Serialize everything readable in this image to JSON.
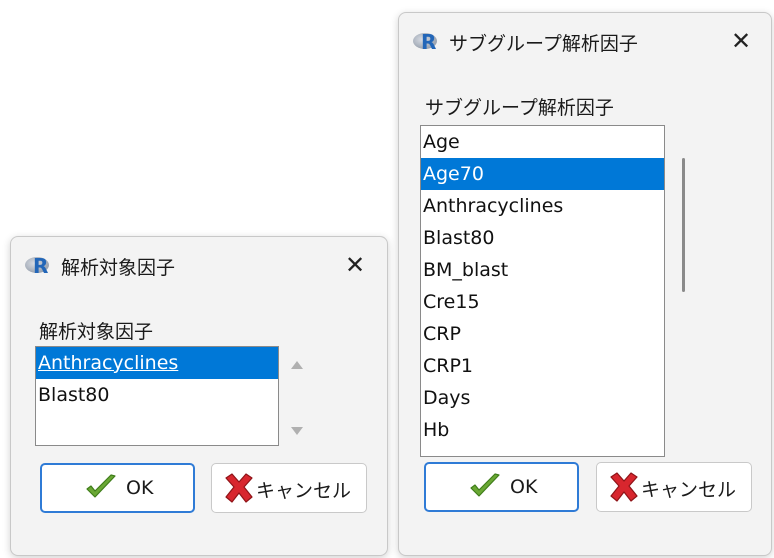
{
  "dialog_left": {
    "title": "解析対象因子",
    "list_label": "解析対象因子",
    "items": [
      "Anthracyclines",
      "Blast80"
    ],
    "selected_index": 0,
    "ok_label": "OK",
    "cancel_label": "キャンセル",
    "close_glyph": "✕"
  },
  "dialog_right": {
    "title": "サブグループ解析因子",
    "list_label": "サブグループ解析因子",
    "items": [
      "Age",
      "Age70",
      "Anthracyclines",
      "Blast80",
      "BM_blast",
      "Cre15",
      "CRP",
      "CRP1",
      "Days",
      "Hb"
    ],
    "selected_index": 1,
    "ok_label": "OK",
    "cancel_label": "キャンセル",
    "close_glyph": "✕"
  },
  "colors": {
    "selection": "#0078d7",
    "dialog_bg": "#f3f3f3",
    "default_button_border": "#2f7bd6",
    "check_green": "#6aa834",
    "cancel_red": "#d8262e"
  },
  "icons": {
    "app_logo": "r-logo-icon",
    "close": "close-icon",
    "ok": "checkmark-icon",
    "cancel": "x-mark-icon",
    "scroll_up": "scroll-up-arrow-icon",
    "scroll_down": "scroll-down-arrow-icon"
  }
}
